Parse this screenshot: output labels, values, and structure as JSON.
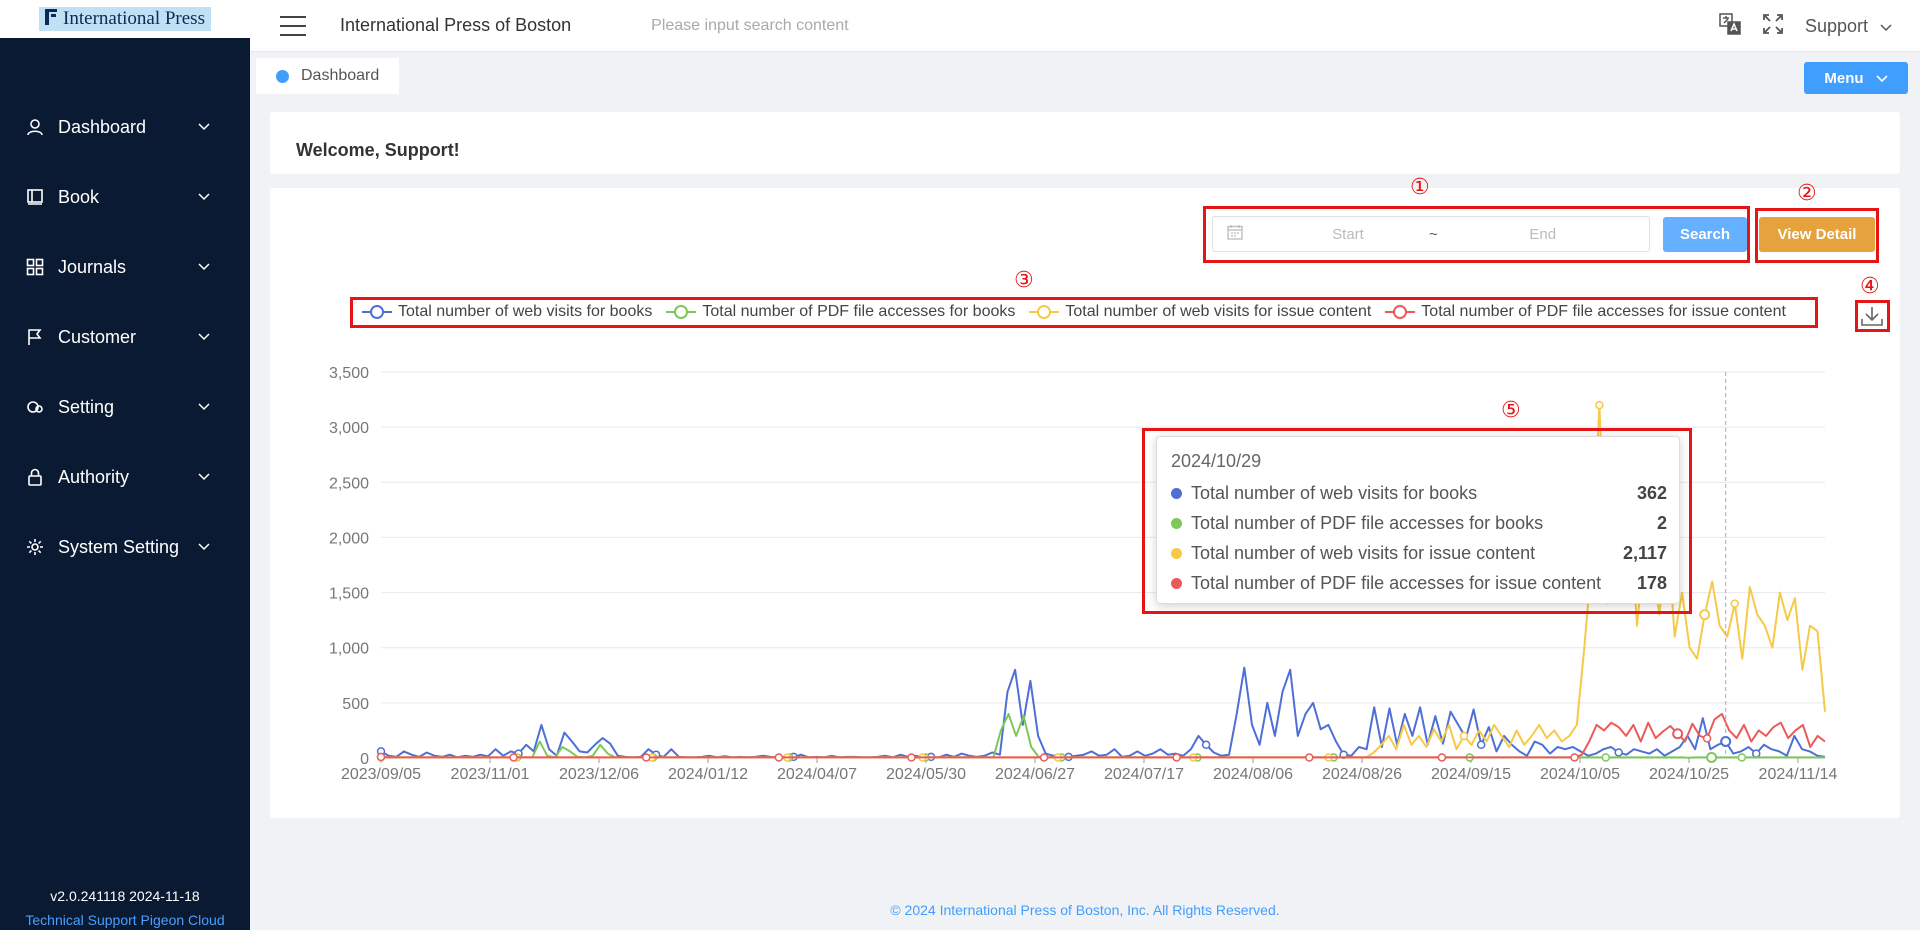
{
  "sidebar": {
    "logo_text": "International Press",
    "items": [
      {
        "label": "Dashboard",
        "icon": "user-icon"
      },
      {
        "label": "Book",
        "icon": "book-icon"
      },
      {
        "label": "Journals",
        "icon": "grid-icon"
      },
      {
        "label": "Customer",
        "icon": "flag-icon"
      },
      {
        "label": "Setting",
        "icon": "search-gear-icon"
      },
      {
        "label": "Authority",
        "icon": "lock-icon"
      },
      {
        "label": "System Setting",
        "icon": "gear-icon"
      }
    ],
    "version": "v2.0.241118 2024-11-18",
    "tech_support": "Technical Support Pigeon Cloud"
  },
  "header": {
    "title": "International Press of Boston",
    "search_placeholder": "Please input search content",
    "user": "Support"
  },
  "tags": {
    "active": "Dashboard",
    "menu_label": "Menu"
  },
  "welcome": "Welcome, Support!",
  "controls": {
    "start_placeholder": "Start",
    "end_placeholder": "End",
    "separator": "~",
    "search_label": "Search",
    "view_detail_label": "View Detail"
  },
  "annotations": [
    "①",
    "②",
    "③",
    "④",
    "⑤"
  ],
  "colors": {
    "books_web": "#4e6fd6",
    "books_pdf": "#7ec85a",
    "issue_web": "#f7c948",
    "issue_pdf": "#eb5a5a",
    "annotation_red": "#e51515",
    "primary": "#409eff",
    "warning": "#e6a23c",
    "sidebar_bg": "#0b1a33"
  },
  "chart_data": {
    "type": "line",
    "x_tick_labels": [
      "2023/09/05",
      "2023/11/01",
      "2023/12/06",
      "2024/01/12",
      "2024/04/07",
      "2024/05/30",
      "2024/06/27",
      "2024/07/17",
      "2024/08/06",
      "2024/08/26",
      "2024/09/15",
      "2024/10/05",
      "2024/10/25",
      "2024/11/14"
    ],
    "y_ticks": [
      0,
      500,
      1000,
      1500,
      2000,
      2500,
      3000,
      3500
    ],
    "ylim": [
      0,
      3500
    ],
    "legend_position": "top",
    "series": [
      {
        "name": "Total number of web visits for books",
        "color": "#4e6fd6",
        "values": [
          60,
          20,
          10,
          60,
          30,
          10,
          50,
          20,
          10,
          30,
          5,
          20,
          10,
          30,
          15,
          80,
          20,
          60,
          40,
          120,
          60,
          300,
          80,
          20,
          230,
          150,
          60,
          50,
          120,
          180,
          130,
          20,
          10,
          5,
          10,
          80,
          30,
          10,
          80,
          10,
          5,
          5,
          10,
          20,
          5,
          15,
          5,
          10,
          5,
          10,
          20,
          10,
          5,
          5,
          10,
          30,
          5,
          10,
          5,
          20,
          5,
          10,
          10,
          5,
          5,
          10,
          20,
          5,
          30,
          10,
          20,
          5,
          10,
          5,
          30,
          10,
          40,
          20,
          10,
          20,
          50,
          30,
          600,
          800,
          300,
          700,
          200,
          40,
          20,
          30,
          10,
          20,
          30,
          60,
          20,
          30,
          80,
          10,
          20,
          60,
          20,
          40,
          80,
          30,
          40,
          20,
          80,
          200,
          120,
          50,
          20,
          30,
          400,
          820,
          300,
          120,
          500,
          200,
          600,
          800,
          200,
          400,
          500,
          260,
          300,
          150,
          30,
          20,
          100,
          80,
          460,
          100,
          450,
          120,
          400,
          200,
          460,
          120,
          380,
          130,
          420,
          300,
          180,
          440,
          120,
          280,
          60,
          200,
          120,
          60,
          20,
          150,
          120,
          40,
          100,
          80,
          100,
          60,
          20,
          40,
          80,
          100,
          50,
          30,
          80,
          60,
          40,
          80,
          20,
          60,
          100,
          200,
          80,
          362,
          80,
          120,
          150,
          40,
          60,
          100,
          40,
          120,
          80,
          60,
          20,
          200,
          80,
          60,
          20,
          10
        ]
      },
      {
        "name": "Total number of PDF file accesses for books",
        "color": "#7ec85a",
        "values": [
          5,
          5,
          5,
          5,
          5,
          5,
          5,
          5,
          5,
          5,
          5,
          5,
          5,
          5,
          5,
          5,
          5,
          5,
          5,
          5,
          5,
          150,
          20,
          5,
          100,
          60,
          10,
          5,
          20,
          120,
          40,
          5,
          5,
          5,
          5,
          5,
          5,
          5,
          5,
          5,
          5,
          5,
          5,
          5,
          5,
          5,
          5,
          5,
          5,
          5,
          5,
          5,
          5,
          5,
          5,
          5,
          5,
          5,
          5,
          5,
          5,
          5,
          5,
          5,
          5,
          5,
          5,
          5,
          5,
          5,
          5,
          5,
          5,
          5,
          5,
          5,
          5,
          5,
          5,
          5,
          5,
          5,
          250,
          400,
          200,
          380,
          100,
          10,
          5,
          5,
          5,
          5,
          5,
          5,
          5,
          5,
          5,
          5,
          5,
          5,
          5,
          5,
          5,
          5,
          5,
          5,
          5,
          5,
          5,
          5,
          5,
          5,
          5,
          5,
          5,
          5,
          5,
          5,
          5,
          5,
          5,
          5,
          5,
          5,
          5,
          5,
          5,
          5,
          5,
          5,
          5,
          5,
          5,
          5,
          5,
          5,
          5,
          5,
          5,
          5,
          5,
          5,
          5,
          5,
          5,
          5,
          5,
          5,
          5,
          5,
          5,
          5,
          5,
          5,
          5,
          5,
          5,
          5,
          5,
          5,
          5,
          5,
          5,
          5,
          5,
          5,
          5,
          5,
          5,
          5,
          5,
          5,
          5,
          2,
          5,
          5,
          5,
          5,
          5,
          5,
          5,
          5,
          5,
          5,
          5,
          5,
          5,
          5,
          5,
          5,
          5,
          5
        ]
      },
      {
        "name": "Total number of web visits for issue content",
        "color": "#f7c948",
        "values": [
          5,
          5,
          5,
          5,
          5,
          5,
          5,
          5,
          5,
          5,
          5,
          5,
          5,
          5,
          5,
          5,
          5,
          5,
          5,
          5,
          5,
          5,
          5,
          5,
          5,
          5,
          5,
          5,
          5,
          5,
          5,
          5,
          5,
          5,
          5,
          5,
          5,
          5,
          5,
          5,
          5,
          5,
          5,
          5,
          5,
          5,
          5,
          5,
          5,
          5,
          5,
          5,
          5,
          5,
          5,
          5,
          5,
          5,
          5,
          5,
          5,
          5,
          5,
          5,
          5,
          5,
          5,
          5,
          5,
          5,
          5,
          5,
          5,
          5,
          5,
          5,
          5,
          5,
          5,
          5,
          5,
          5,
          5,
          5,
          5,
          5,
          5,
          5,
          5,
          5,
          5,
          5,
          5,
          5,
          5,
          5,
          5,
          5,
          5,
          5,
          5,
          5,
          5,
          5,
          5,
          5,
          5,
          5,
          5,
          5,
          5,
          5,
          5,
          5,
          5,
          5,
          5,
          5,
          5,
          5,
          5,
          5,
          5,
          5,
          5,
          5,
          5,
          5,
          5,
          5,
          5,
          5,
          50,
          120,
          200,
          80,
          300,
          120,
          200,
          100,
          260,
          150,
          300,
          80,
          200,
          120,
          250,
          150,
          300,
          200,
          100,
          250,
          120,
          200,
          300,
          180,
          250,
          150,
          200,
          300,
          1000,
          1800,
          3200,
          1400,
          2000,
          1800,
          2300,
          1200,
          1900,
          1700,
          1300,
          2117,
          1100,
          1500,
          1000,
          900,
          1300,
          1600,
          1200,
          1100,
          1400,
          900,
          1550,
          1300,
          1200,
          1000,
          1500,
          1250,
          1450,
          800,
          1200,
          1150,
          420
        ]
      },
      {
        "name": "Total number of PDF file accesses for issue content",
        "color": "#eb5a5a",
        "values": [
          10,
          5,
          5,
          5,
          5,
          5,
          5,
          5,
          5,
          5,
          5,
          5,
          5,
          5,
          5,
          5,
          5,
          5,
          5,
          5,
          5,
          5,
          5,
          5,
          5,
          5,
          5,
          5,
          5,
          5,
          5,
          5,
          5,
          5,
          5,
          5,
          5,
          5,
          5,
          5,
          5,
          5,
          5,
          5,
          5,
          5,
          5,
          5,
          5,
          5,
          5,
          5,
          5,
          5,
          5,
          5,
          5,
          5,
          5,
          5,
          5,
          5,
          5,
          5,
          5,
          5,
          5,
          5,
          5,
          5,
          5,
          5,
          5,
          5,
          5,
          5,
          5,
          5,
          5,
          5,
          5,
          5,
          5,
          5,
          5,
          5,
          5,
          5,
          5,
          5,
          5,
          5,
          5,
          5,
          5,
          5,
          5,
          5,
          5,
          5,
          5,
          5,
          5,
          5,
          5,
          5,
          5,
          5,
          5,
          5,
          5,
          5,
          5,
          5,
          5,
          5,
          5,
          5,
          5,
          5,
          5,
          5,
          5,
          5,
          5,
          5,
          5,
          5,
          5,
          5,
          5,
          5,
          5,
          5,
          5,
          5,
          5,
          5,
          5,
          5,
          5,
          5,
          5,
          5,
          5,
          5,
          5,
          5,
          5,
          5,
          5,
          5,
          5,
          5,
          5,
          5,
          5,
          5,
          5,
          5,
          5,
          5,
          5,
          30,
          150,
          300,
          250,
          320,
          280,
          200,
          300,
          150,
          320,
          180,
          240,
          290,
          220,
          150,
          310,
          200,
          178,
          350,
          400,
          250,
          180,
          300,
          150,
          250,
          200,
          280,
          320,
          180,
          250,
          300,
          100,
          200,
          150
        ]
      }
    ],
    "tooltip": {
      "date": "2024/10/29",
      "rows": [
        {
          "name": "Total number of web visits for books",
          "value": "362",
          "color": "#4e6fd6"
        },
        {
          "name": "Total number of PDF file accesses for books",
          "value": "2",
          "color": "#7ec85a"
        },
        {
          "name": "Total number of web visits for issue content",
          "value": "2,117",
          "color": "#f7c948"
        },
        {
          "name": "Total number of PDF file accesses for issue content",
          "value": "178",
          "color": "#eb5a5a"
        }
      ]
    }
  },
  "footer": "© 2024 International Press of Boston, Inc. All Rights Reserved."
}
